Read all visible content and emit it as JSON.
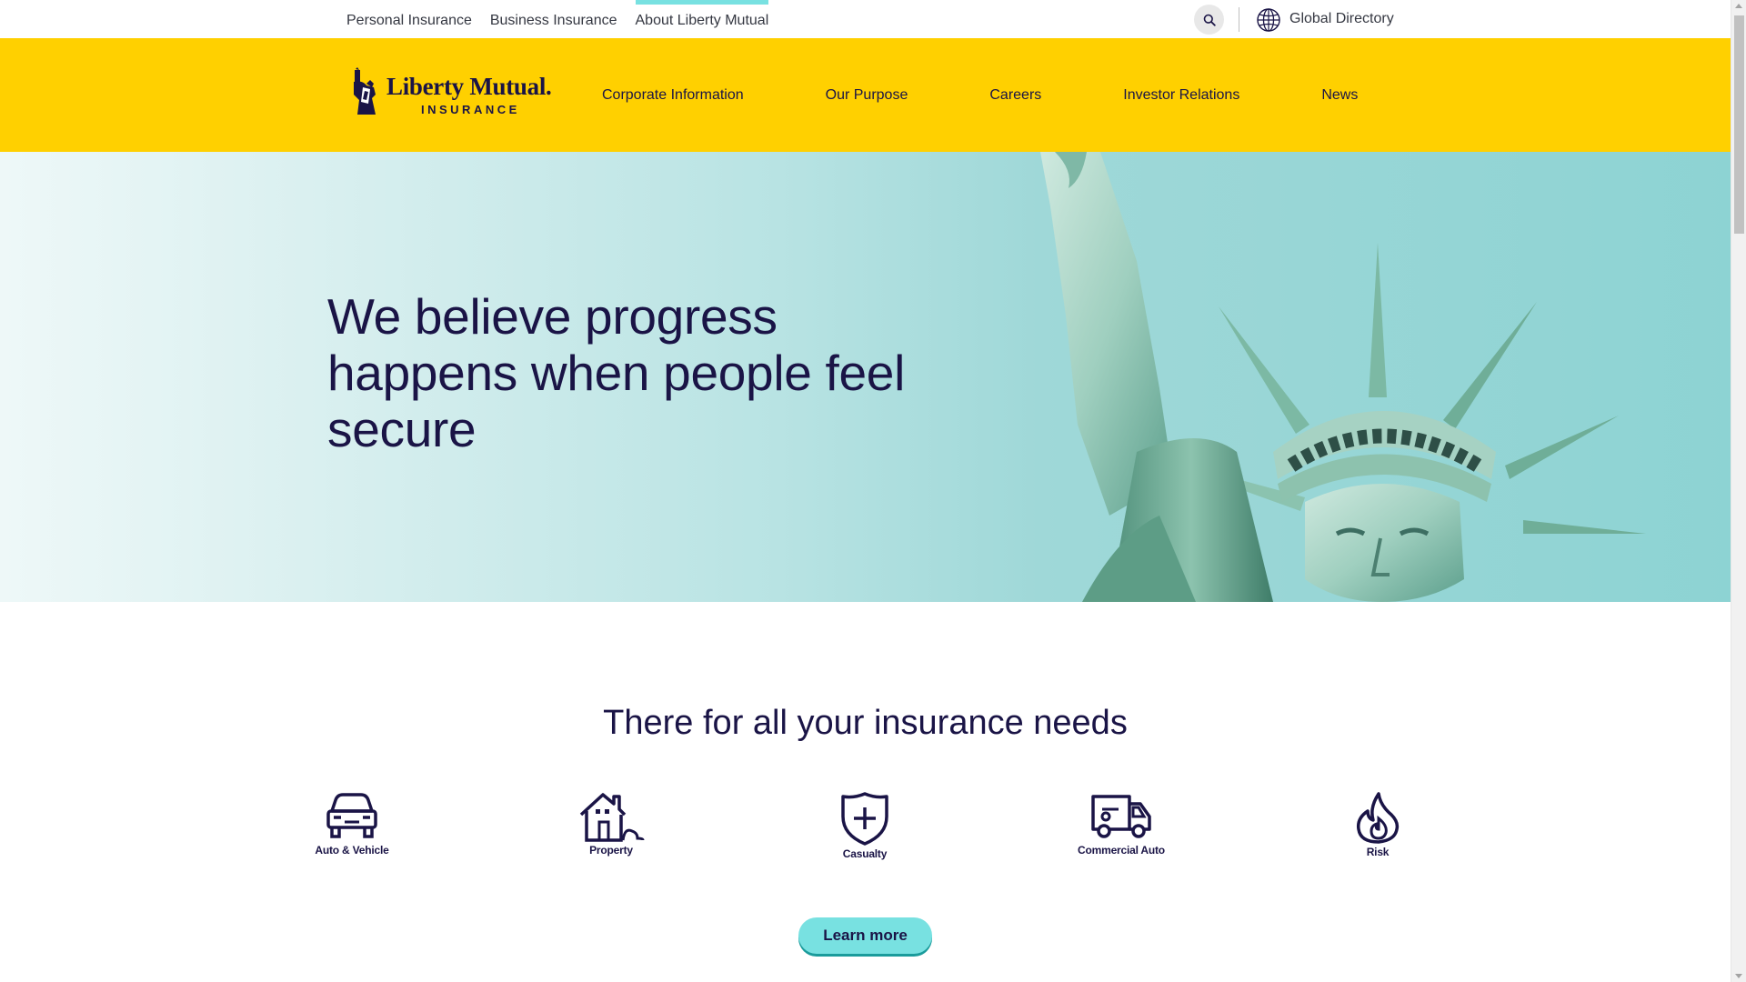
{
  "utility": {
    "links": [
      {
        "label": "Personal Insurance"
      },
      {
        "label": "Business Insurance"
      },
      {
        "label": "About Liberty Mutual"
      }
    ],
    "global_directory": "Global Directory",
    "search_icon": "search-icon",
    "globe_icon": "globe-icon"
  },
  "mainnav": {
    "logo_name": "Liberty Mutual.",
    "logo_sub": "INSURANCE",
    "items": [
      {
        "label": "Corporate Information"
      },
      {
        "label": "Our Purpose"
      },
      {
        "label": "Careers"
      },
      {
        "label": "Investor Relations"
      },
      {
        "label": "News"
      }
    ]
  },
  "hero": {
    "title": "We believe progress happens when people feel secure"
  },
  "needs": {
    "title": "There for all your insurance needs",
    "products": [
      {
        "label": "Auto & Vehicle",
        "icon": "car-icon"
      },
      {
        "label": "Property",
        "icon": "house-icon"
      },
      {
        "label": "Casualty",
        "icon": "shield-plus-icon"
      },
      {
        "label": "Commercial Auto",
        "icon": "truck-icon"
      },
      {
        "label": "Risk",
        "icon": "flame-icon"
      }
    ],
    "cta": "Learn more"
  },
  "colors": {
    "brand_yellow": "#ffd000",
    "brand_navy": "#1a1446",
    "accent_teal": "#78e1e1"
  }
}
